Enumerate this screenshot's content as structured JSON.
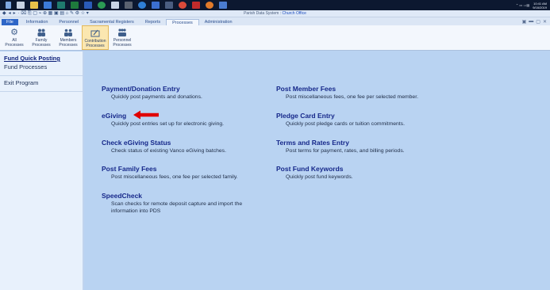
{
  "window": {
    "app_title": "Parish Data System :",
    "site": "Church Office",
    "clock_time": "10:41 AM",
    "clock_date": "9/16/2019"
  },
  "colors": {
    "accent": "#1f3a93",
    "ribbon_active": "#fbe7b0",
    "arrow": "#e00000"
  },
  "menu_tabs": [
    {
      "label": "File"
    },
    {
      "label": "Information"
    },
    {
      "label": "Personnel"
    },
    {
      "label": "Sacramental Registers"
    },
    {
      "label": "Reports"
    },
    {
      "label": "Processes"
    },
    {
      "label": "Administration"
    }
  ],
  "ribbon": [
    {
      "line1": "All",
      "line2": "Processes",
      "icon": "gear-icon"
    },
    {
      "line1": "Family",
      "line2": "Processes",
      "icon": "family-icon"
    },
    {
      "line1": "Members",
      "line2": "Processes",
      "icon": "members-icon"
    },
    {
      "line1": "Contribution",
      "line2": "Processes",
      "icon": "contribution-icon"
    },
    {
      "line1": "Personnel",
      "line2": "Processes",
      "icon": "personnel-icon"
    }
  ],
  "sidebar": {
    "items": [
      {
        "label": "Fund Quick Posting"
      },
      {
        "label": "Fund Processes"
      },
      {
        "label": "Exit Program"
      }
    ]
  },
  "processes": {
    "payment_entry": {
      "title": "Payment/Donation Entry",
      "desc": "Quickly post payments and donations."
    },
    "egiving": {
      "title": "eGiving",
      "desc": "Quickly post entries set up for electronic giving."
    },
    "check_egiving": {
      "title": "Check eGiving Status",
      "desc": "Check status of existing Vanco eGiving batches."
    },
    "post_family_fees": {
      "title": "Post Family Fees",
      "desc": "Post miscellaneous fees, one fee per selected family."
    },
    "speedcheck": {
      "title": "SpeedCheck",
      "desc": "Scan checks for remote deposit capture and import the information into PDS"
    },
    "post_member_fees": {
      "title": "Post Member Fees",
      "desc": "Post miscellaneous fees, one fee per selected member."
    },
    "pledge_card": {
      "title": "Pledge Card Entry",
      "desc": "Quickly post pledge cards or tuition commitments."
    },
    "terms_rates": {
      "title": "Terms and Rates Entry",
      "desc": "Post terms for payment, rates, and billing periods."
    },
    "fund_keywords": {
      "title": "Post Fund Keywords",
      "desc": "Quickly post fund keywords."
    }
  }
}
